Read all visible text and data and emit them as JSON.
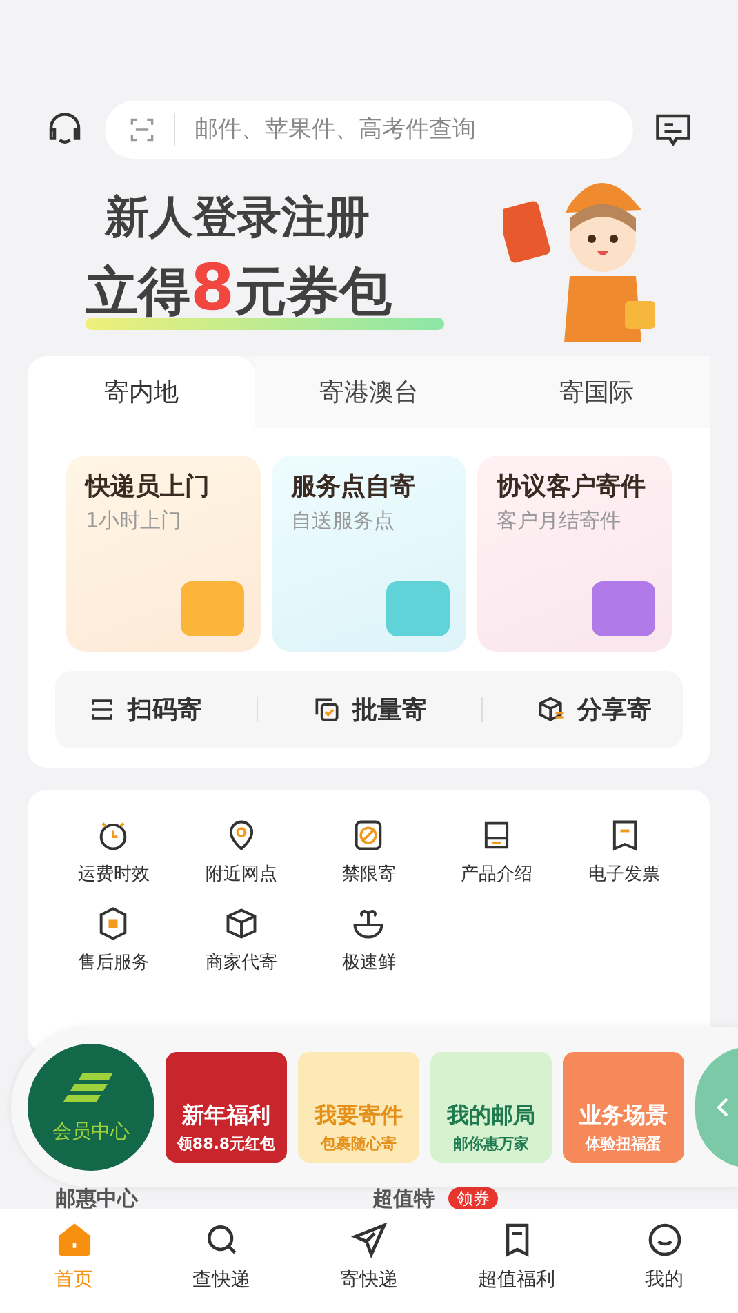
{
  "search": {
    "placeholder": "邮件、苹果件、高考件查询"
  },
  "banner": {
    "line1": "新人登录注册",
    "line2_prefix": "立得",
    "line2_highlight": "8",
    "line2_suffix": "元券包"
  },
  "ship_tabs": [
    {
      "label": "寄内地",
      "selected": true
    },
    {
      "label": "寄港澳台",
      "selected": false
    },
    {
      "label": "寄国际",
      "selected": false
    }
  ],
  "ship_cards": [
    {
      "title": "快递员上门",
      "subtitle": "1小时上门",
      "color": "#fbb53a"
    },
    {
      "title": "服务点自寄",
      "subtitle": "自送服务点",
      "color": "#5fd3d8"
    },
    {
      "title": "协议客户寄件",
      "subtitle": "客户月结寄件",
      "color": "#b07be8"
    }
  ],
  "quick_actions": [
    "扫码寄",
    "批量寄",
    "分享寄"
  ],
  "services": [
    "运费时效",
    "附近网点",
    "禁限寄",
    "产品介绍",
    "电子发票",
    "售后服务",
    "商家代寄",
    "极速鲜"
  ],
  "promo": {
    "member": "会员中心",
    "tiles": [
      {
        "title": "新年福利",
        "subtitle": "领88.8元红包"
      },
      {
        "title": "我要寄件",
        "subtitle": "包裹随心寄"
      },
      {
        "title": "我的邮局",
        "subtitle": "邮你惠万家"
      },
      {
        "title": "业务场景",
        "subtitle": "体验扭福蛋"
      }
    ]
  },
  "peek": {
    "left": "邮惠中心",
    "right": "超值特",
    "badge": "领券"
  },
  "nav": [
    {
      "label": "首页",
      "selected": true
    },
    {
      "label": "查快递",
      "selected": false
    },
    {
      "label": "寄快递",
      "selected": false
    },
    {
      "label": "超值福利",
      "selected": false
    },
    {
      "label": "我的",
      "selected": false
    }
  ]
}
